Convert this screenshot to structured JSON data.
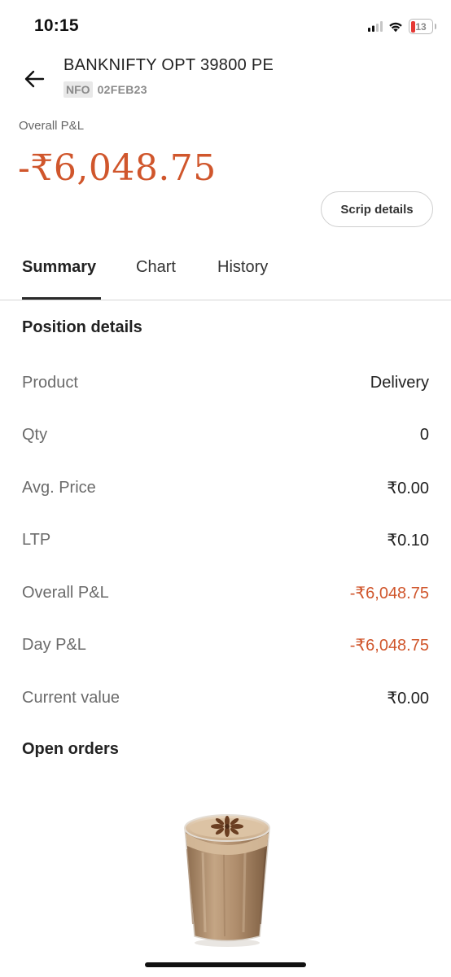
{
  "status_bar": {
    "time": "10:15",
    "battery_level": "13",
    "icons": [
      "cellular-signal-icon",
      "wifi-icon",
      "battery-icon"
    ]
  },
  "header": {
    "back_icon": "arrow-left-icon",
    "instrument": "BANKNIFTY OPT 39800 PE",
    "exchange": "NFO",
    "expiry": "02FEB23"
  },
  "pnl": {
    "label": "Overall P&L",
    "value": "-₹6,048.75"
  },
  "scrip_button_label": "Scrip details",
  "tabs": [
    {
      "label": "Summary",
      "active": true
    },
    {
      "label": "Chart",
      "active": false
    },
    {
      "label": "History",
      "active": false
    }
  ],
  "position_details": {
    "heading": "Position details",
    "rows": [
      {
        "label": "Product",
        "value": "Delivery"
      },
      {
        "label": "Qty",
        "value": "0"
      },
      {
        "label": "Avg. Price",
        "value": "₹0.00"
      },
      {
        "label": "LTP",
        "value": "₹0.10"
      },
      {
        "label": "Overall P&L",
        "value": "-₹6,048.75"
      },
      {
        "label": "Day P&L",
        "value": "-₹6,048.75"
      },
      {
        "label": "Current value",
        "value": "₹0.00"
      }
    ]
  },
  "open_orders": {
    "heading": "Open orders",
    "illustration": "chai-glass-illustration"
  },
  "colors": {
    "negative": "#d0562c",
    "text_primary": "#222222",
    "text_secondary": "#6b6b6b",
    "tab_underline": "#2a2a2a"
  }
}
